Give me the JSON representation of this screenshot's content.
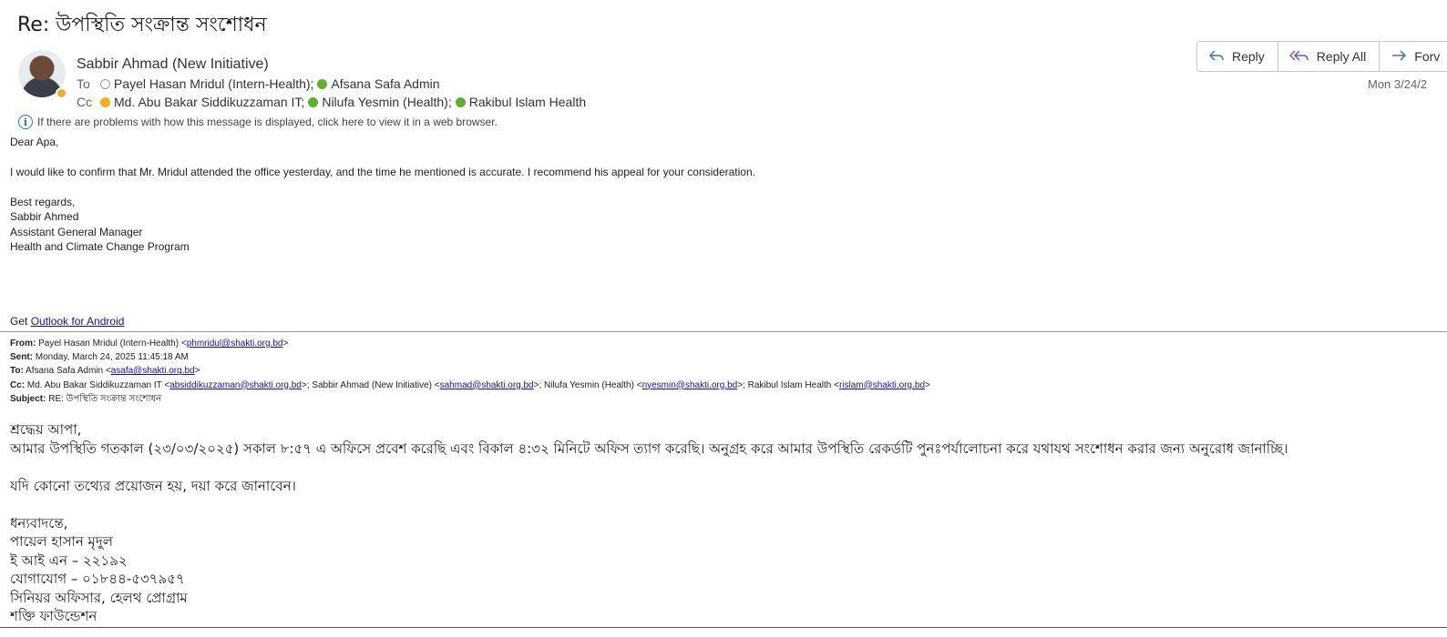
{
  "subject": "Re: উপস্থিতি সংক্রান্ত সংশোধন",
  "sender": {
    "name": "Sabbir Ahmad (New Initiative)"
  },
  "to": {
    "label": "To",
    "recipients": [
      {
        "name": "Payel Hasan Mridul (Intern-Health);",
        "status": "offline"
      },
      {
        "name": "Afsana Safa Admin",
        "status": "available"
      }
    ]
  },
  "cc": {
    "label": "Cc",
    "recipients": [
      {
        "name": "Md. Abu Bakar Siddikuzzaman IT;",
        "status": "away"
      },
      {
        "name": "Nilufa Yesmin (Health);",
        "status": "available"
      },
      {
        "name": "Rakibul Islam Health",
        "status": "available"
      }
    ]
  },
  "date": "Mon 3/24/2",
  "actions": {
    "reply": "Reply",
    "reply_all": "Reply All",
    "forward": "Forv"
  },
  "info_banner": "If there are problems with how this message is displayed, click here to view it in a web browser.",
  "reply_body": {
    "greeting": "Dear Apa,",
    "paragraph": "I would like to confirm that Mr. Mridul attended the office yesterday, and the time he mentioned is accurate. I recommend his appeal for your consideration.",
    "closing": "Best regards,",
    "sig_name": "Sabbir Ahmed",
    "sig_title": "Assistant General Manager",
    "sig_program": "Health and Climate Change Program",
    "get_prefix": "Get ",
    "get_link": "Outlook for Android"
  },
  "original": {
    "from_label": "From:",
    "from_name": " Payel Hasan Mridul (Intern-Health) <",
    "from_email": "phmridul@shakti.org.bd",
    "sent_label": "Sent:",
    "sent_value": " Monday, March 24, 2025 11:45:18 AM",
    "to_label": "To:",
    "to_name": " Afsana Safa Admin <",
    "to_email": "asafa@shakti.org.bd",
    "cc_label": "Cc:",
    "cc_1_name": " Md. Abu Bakar Siddikuzzaman IT <",
    "cc_1_email": "absiddikuzzaman@shakti.org.bd",
    "cc_2_name": ">; Sabbir Ahmad (New Initiative) <",
    "cc_2_email": "sahmad@shakti.org.bd",
    "cc_3_name": ">; Nilufa Yesmin (Health) <",
    "cc_3_email": "nyesmin@shakti.org.bd",
    "cc_4_name": ">; Rakibul Islam Health <",
    "cc_4_email": "rislam@shakti.org.bd",
    "close_bracket": ">",
    "subject_label": "Subject:",
    "subject_value": " RE: উপস্থিতি সংক্রান্ত সংশোধন",
    "lines": [
      "শ্রদ্ধেয় আপা,",
      "আমার উপস্থিতি গতকাল (২৩/০৩/২০২৫) সকাল ৮:৫৭ এ অফিসে প্রবেশ করেছি এবং বিকাল ৪:৩২ মিনিটে অফিস ত্যাগ করেছি। অনুগ্রহ করে আমার উপস্থিতি রেকর্ডটি পুনঃপর্যালোচনা করে যথাযথ সংশোধন করার জন্য অনুরোধ জানাচ্ছি।",
      "যদি কোনো তথ্যের প্রয়োজন হয়, দয়া করে জানাবেন।",
      "ধন্যবাদন্তে,",
      "পায়েল হাসান মৃদুল",
      "ই আই এন – ২২১৯২",
      "যোগাযোগ – ০১৮৪৪-৫৩৭৯৫৭",
      "সিনিয়র অফিসার, হেলথ প্রোগ্রাম",
      "শক্তি ফাউন্ডেশন"
    ]
  },
  "colors": {
    "link": "#1a0dab",
    "available": "#5fae2d",
    "away": "#f2b01e",
    "info": "#2672d6"
  },
  "icons": [
    "reply-icon",
    "reply-all-icon",
    "forward-icon",
    "info-icon"
  ]
}
